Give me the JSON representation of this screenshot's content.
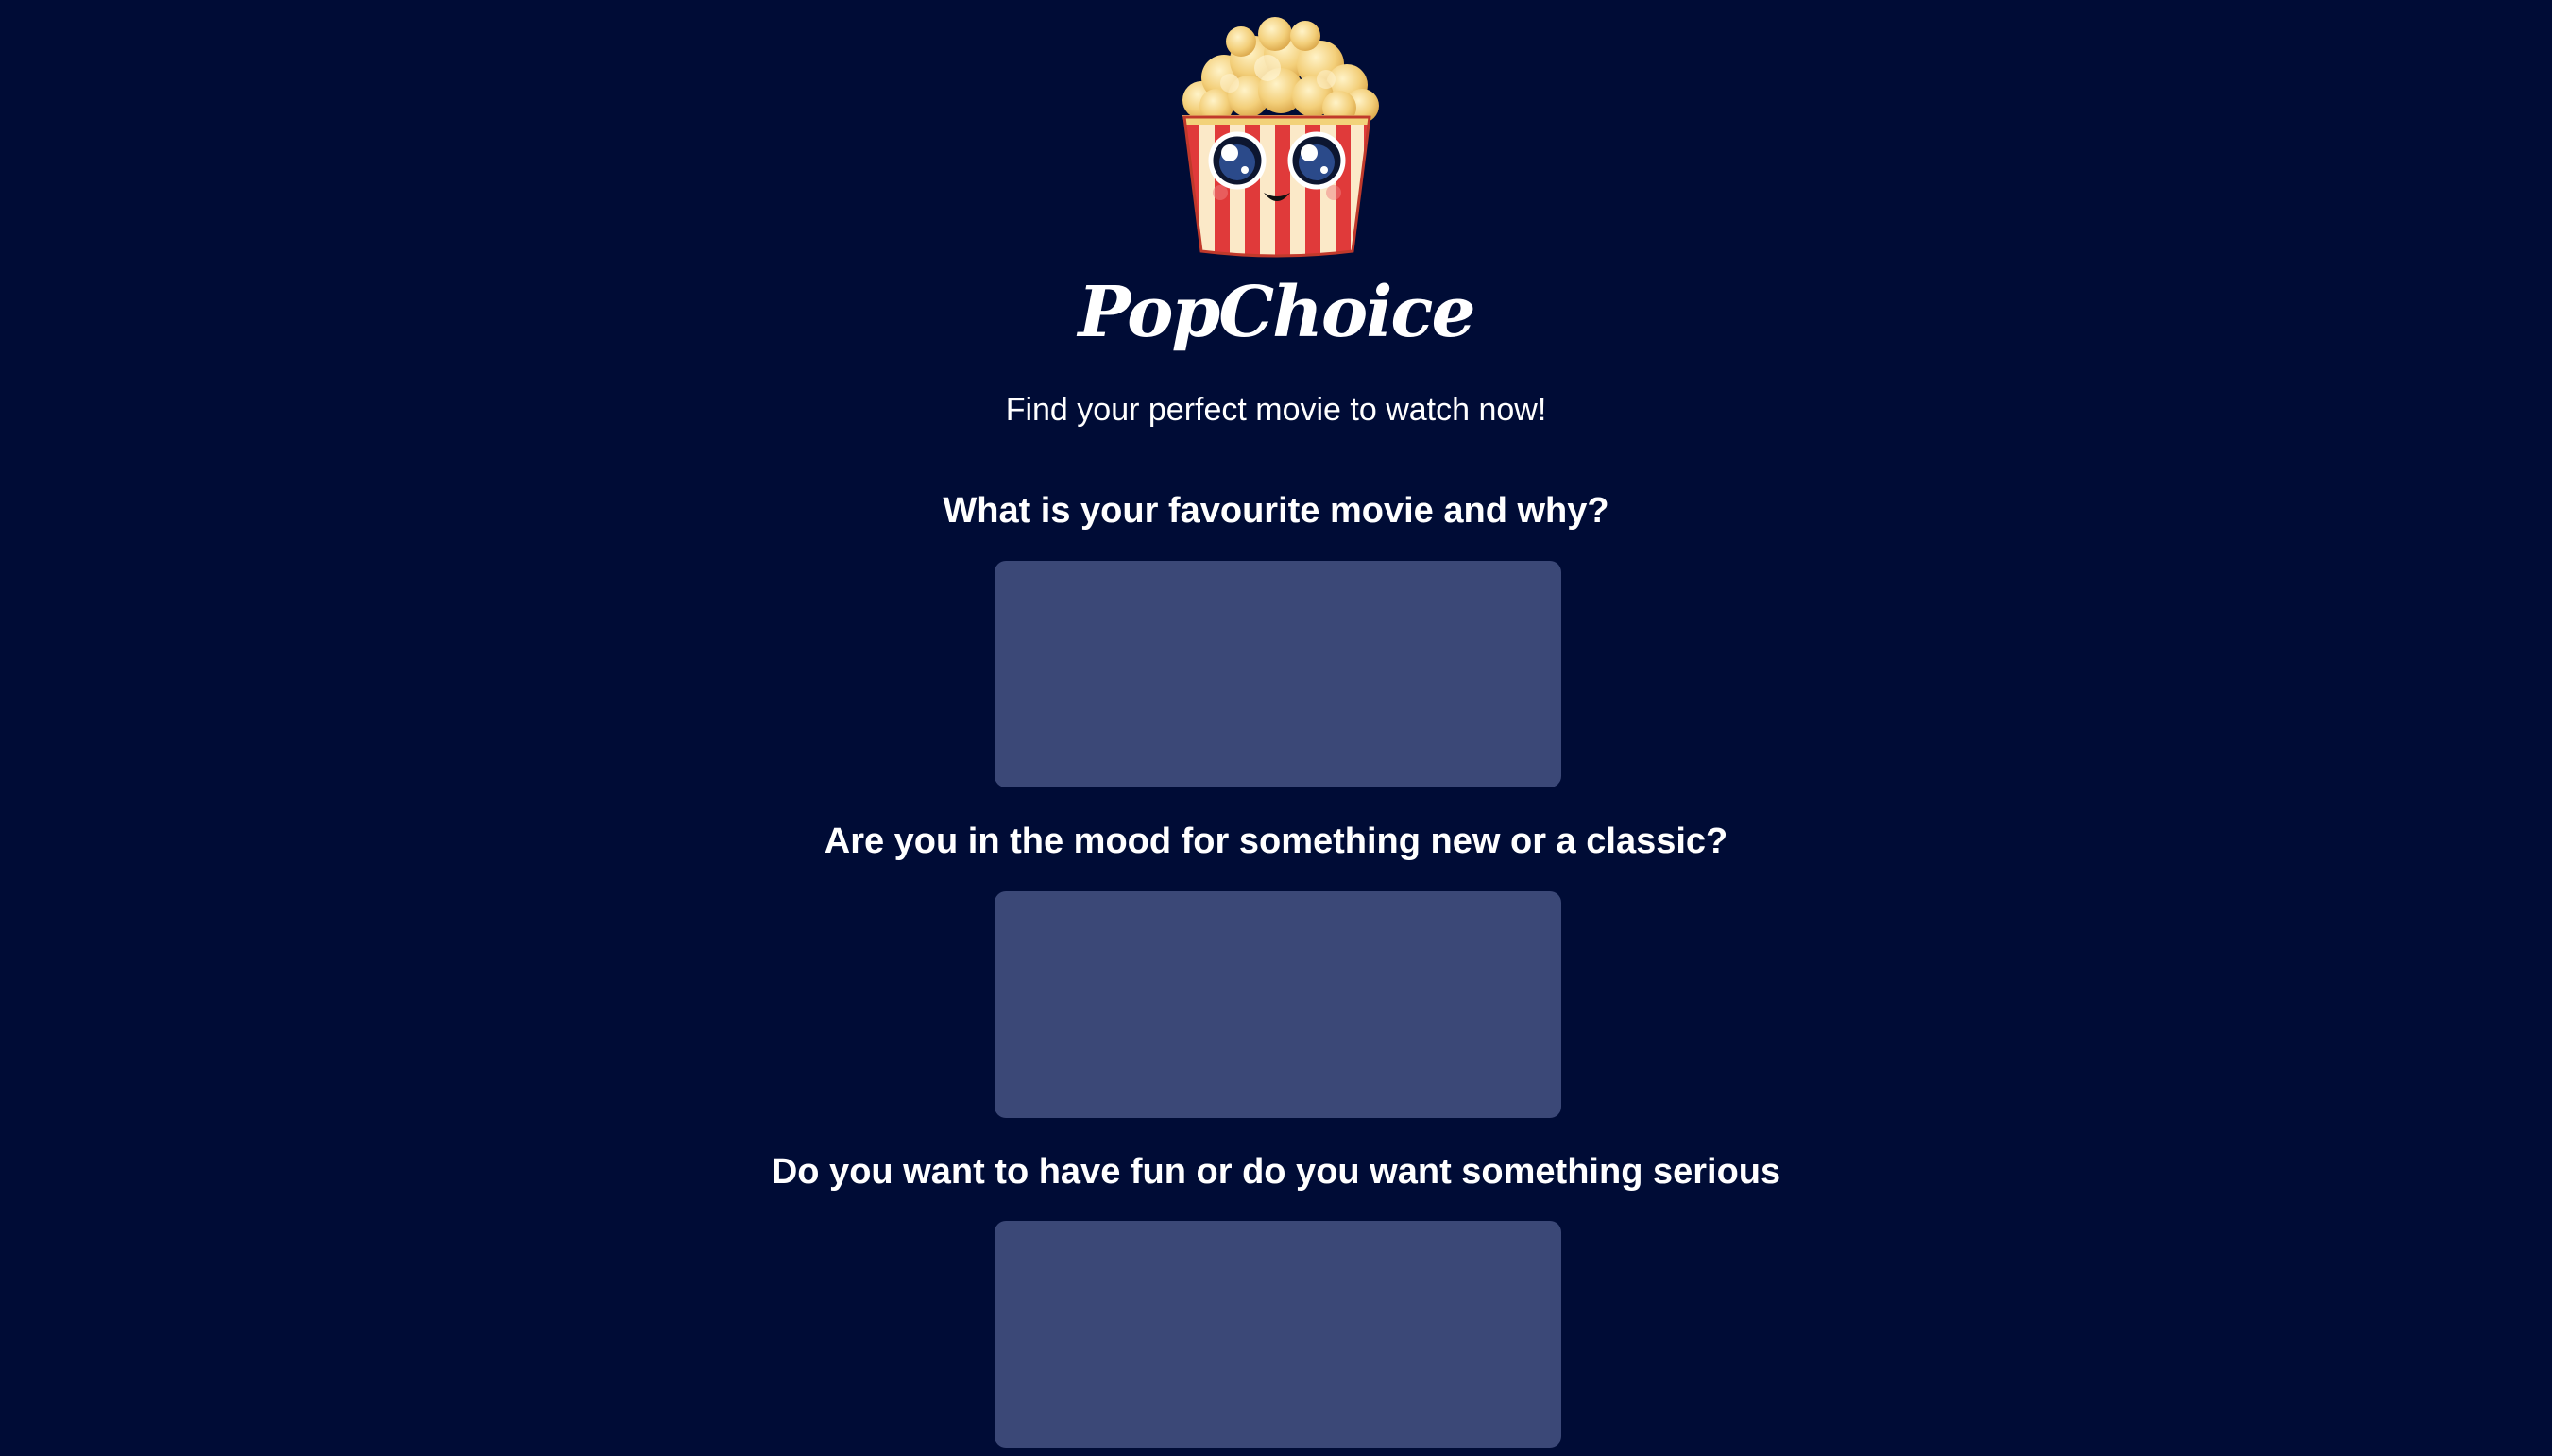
{
  "app": {
    "title": "PopChoice",
    "tagline": "Find your perfect movie to watch now!",
    "logo_icon": "popcorn-mascot-icon"
  },
  "questions": [
    {
      "label": "What is your favourite movie and why?",
      "value": "",
      "placeholder": ""
    },
    {
      "label": "Are you in the mood for something new or a classic?",
      "value": "",
      "placeholder": ""
    },
    {
      "label": "Do you want to have fun or do you want something serious",
      "value": "",
      "placeholder": ""
    }
  ],
  "colors": {
    "background": "#000c36",
    "input_background": "#3b4877",
    "text": "#ffffff"
  }
}
